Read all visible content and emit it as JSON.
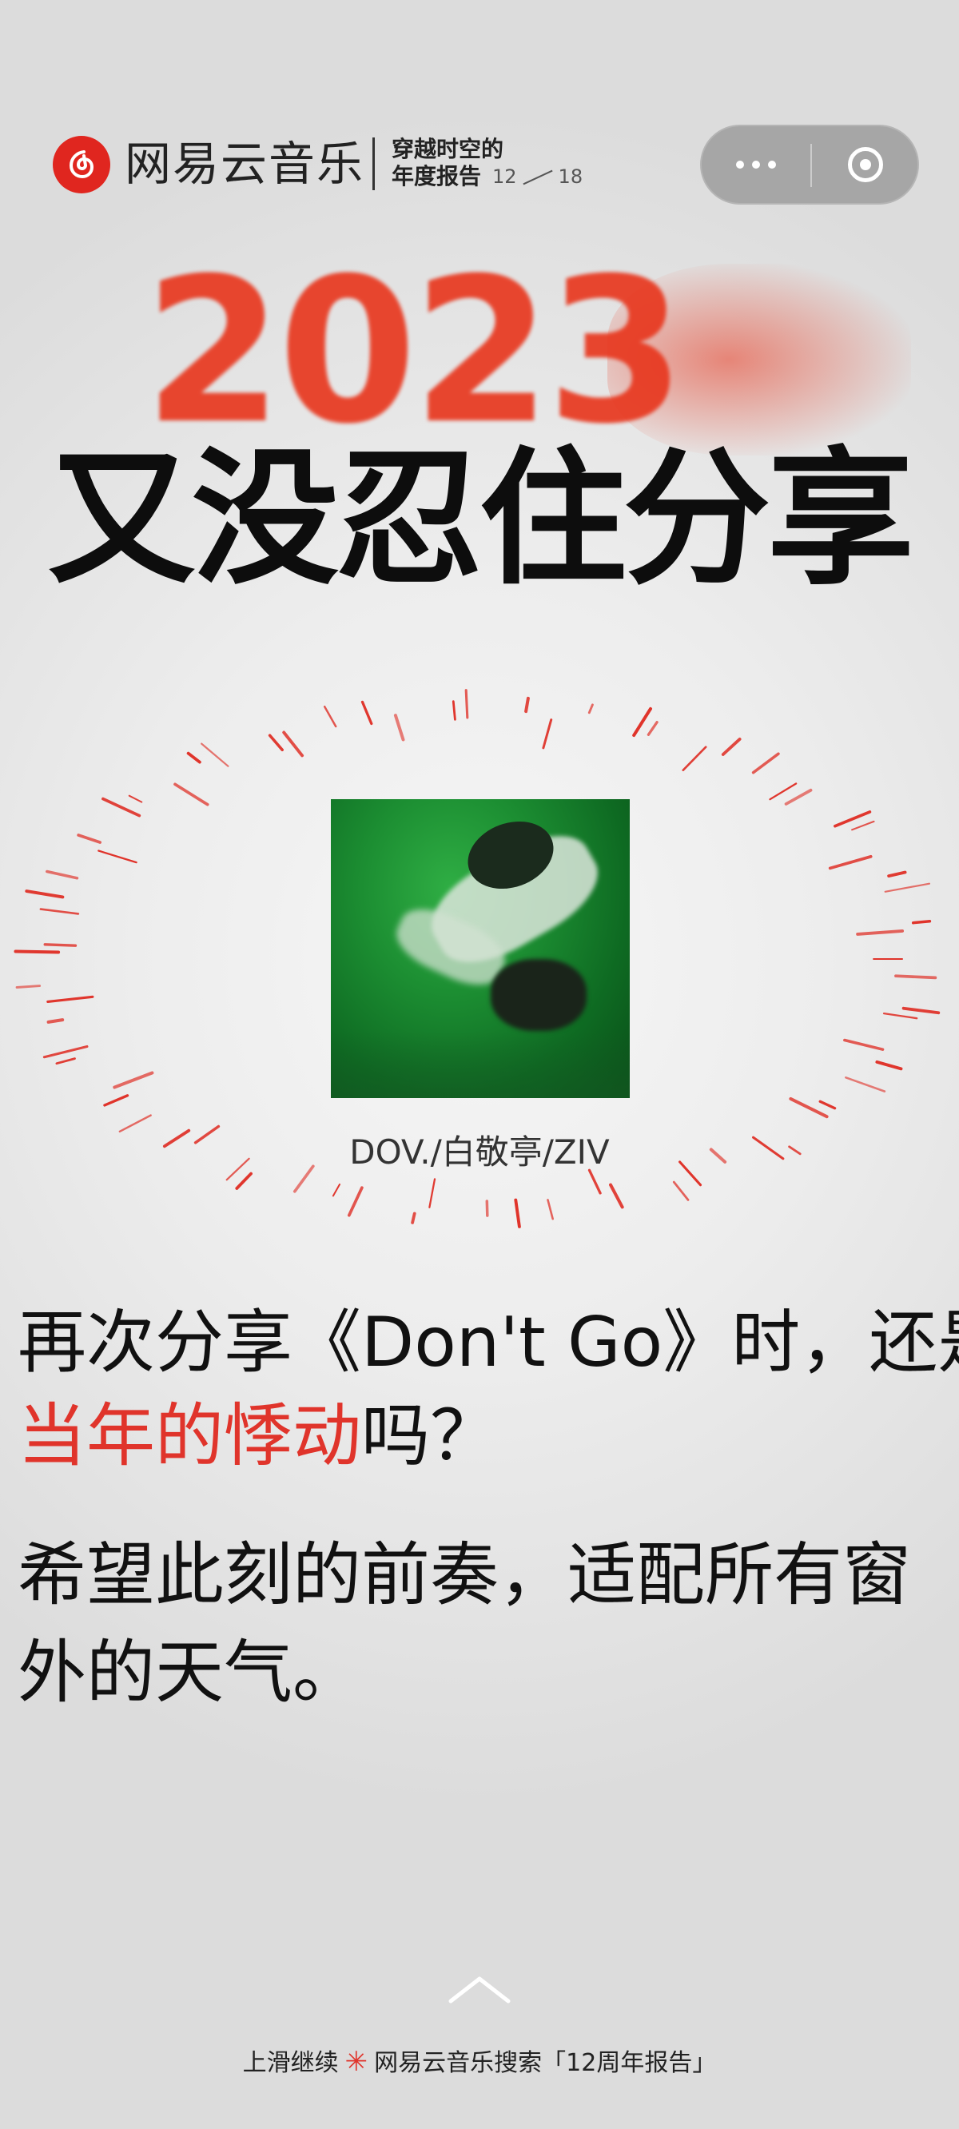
{
  "header": {
    "brand_name": "网易云音乐",
    "report_title_line1": "穿越时空的",
    "report_title_line2": "年度报告",
    "page_current": "12",
    "page_total": "18"
  },
  "hero": {
    "year": "2023",
    "headline": "又没忍住分享"
  },
  "song": {
    "artist": "DOV./白敬亭/ZIV"
  },
  "message": {
    "line1": "再次分享《Don't Go》时，还是",
    "line2_highlight": "当年的悸动",
    "line2_rest": "吗？",
    "line3": "希望此刻的前奏，适配所有窗外的天气。"
  },
  "footer": {
    "swipe_text": "上滑继续",
    "search_text": "网易云音乐搜索「12周年报告」"
  },
  "colors": {
    "accent": "#e0342b",
    "year": "#e8381f"
  }
}
